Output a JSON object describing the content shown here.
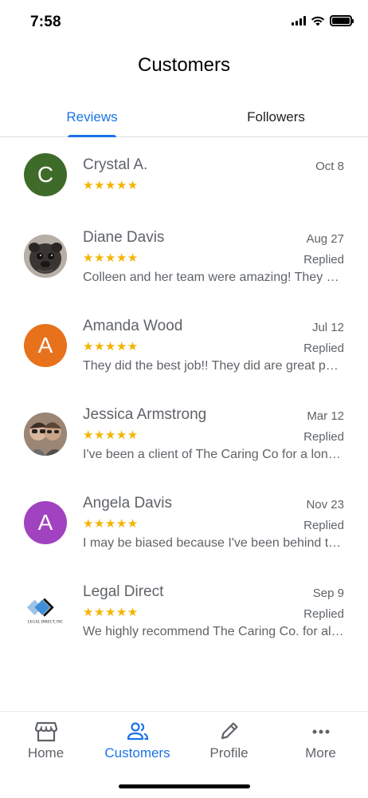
{
  "status_bar": {
    "time": "7:58"
  },
  "header": {
    "title": "Customers"
  },
  "tabs": [
    {
      "label": "Reviews",
      "active": true
    },
    {
      "label": "Followers",
      "active": false
    }
  ],
  "reviews": [
    {
      "name": "Crystal A.",
      "date": "Oct 8",
      "rating": "★★★★★",
      "replied": "",
      "snippet": "",
      "avatar_letter": "C",
      "avatar_color": "#3f6b2a",
      "avatar_type": "letter"
    },
    {
      "name": "Diane Davis",
      "date": "Aug 27",
      "rating": "★★★★★",
      "replied": "Replied",
      "snippet": "Colleen and her team were amazing! They were so helpful and kind",
      "avatar_letter": "",
      "avatar_color": "#4a4542",
      "avatar_type": "photo-dog"
    },
    {
      "name": "Amanda Wood",
      "date": "Jul 12",
      "rating": "★★★★★",
      "replied": "Replied",
      "snippet": "They did the best job!! They did are great people and so helpful",
      "avatar_letter": "A",
      "avatar_color": "#e8711c",
      "avatar_type": "letter"
    },
    {
      "name": "Jessica Armstrong",
      "date": "Mar 12",
      "rating": "★★★★★",
      "replied": "Replied",
      "snippet": "I've been a client of The Caring Co for a long time now and love them",
      "avatar_letter": "",
      "avatar_color": "#6b5a4e",
      "avatar_type": "photo-people"
    },
    {
      "name": "Angela Davis",
      "date": "Nov 23",
      "rating": "★★★★★",
      "replied": "Replied",
      "snippet": "I may be biased because I've been behind the scenes with this team",
      "avatar_letter": "A",
      "avatar_color": "#a142c0",
      "avatar_type": "letter"
    },
    {
      "name": "Legal Direct",
      "date": "Sep 9",
      "rating": "★★★★★",
      "replied": "Replied",
      "snippet": "We highly recommend The Caring Co. for all of your care needs",
      "avatar_letter": "",
      "avatar_color": "#ffffff",
      "avatar_type": "logo",
      "logo_text": "LEGAL DIRECT, INC"
    }
  ],
  "bottom_nav": [
    {
      "label": "Home",
      "icon": "storefront-icon",
      "active": false
    },
    {
      "label": "Customers",
      "icon": "people-icon",
      "active": true
    },
    {
      "label": "Profile",
      "icon": "pencil-icon",
      "active": false
    },
    {
      "label": "More",
      "icon": "more-dots-icon",
      "active": false
    }
  ],
  "colors": {
    "accent": "#1a73e8",
    "star": "#f4b400",
    "text_secondary": "#5f6368"
  }
}
